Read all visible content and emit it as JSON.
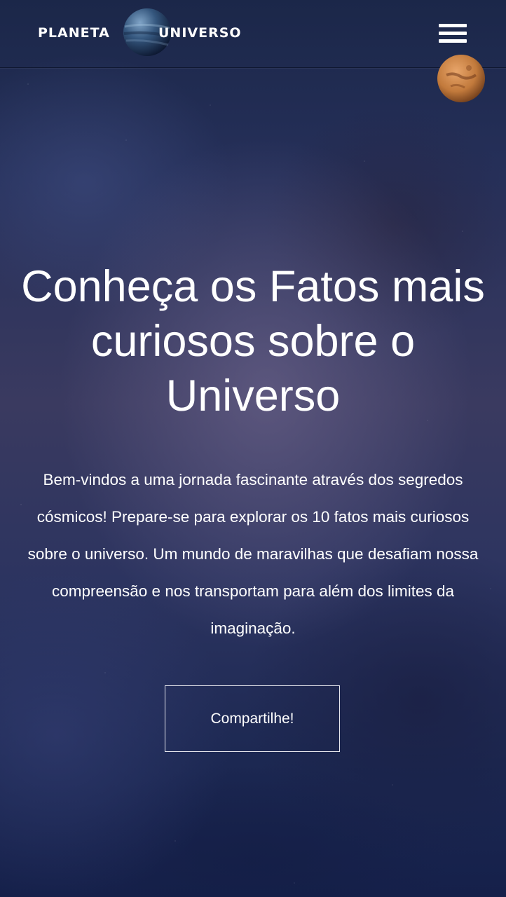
{
  "header": {
    "logo_left": "PLANETA",
    "logo_right": "UNIVERSO",
    "logo_planet_icon": "blue-planet-icon",
    "menu_icon": "hamburger-menu-icon",
    "decoration_icon": "mars-planet-icon"
  },
  "hero": {
    "title": "Conheça os Fatos mais curiosos sobre o Universo",
    "text": "Bem-vindos a uma jornada fascinante através dos segredos cósmicos! Prepare-se para explorar os 10 fatos mais curiosos sobre o universo. Um mundo de maravilhas que desafiam nossa compreensão e nos transportam para além dos limites da imaginação.",
    "share_label": "Compartilhe!"
  },
  "colors": {
    "background": "#26305a",
    "text": "#ffffff",
    "mars": "#c9803f"
  }
}
